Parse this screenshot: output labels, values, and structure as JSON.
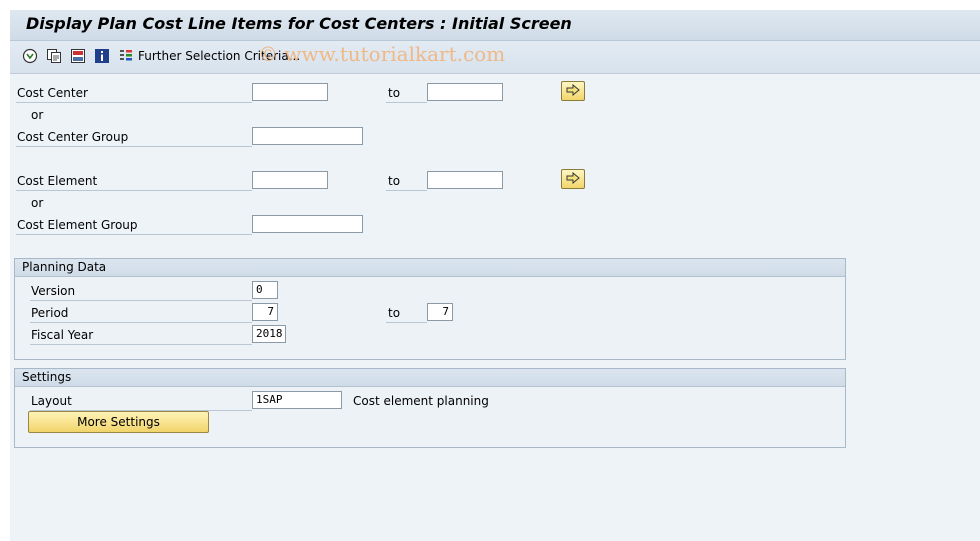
{
  "window": {
    "title": "Display Plan Cost Line Items for Cost Centers : Initial Screen"
  },
  "watermark": "© www.tutorialkart.com",
  "toolbar": {
    "further_selection_label": "Further Selection Criteria..."
  },
  "selection": {
    "cost_center_label": "Cost Center",
    "cost_center_from": "",
    "cost_center_to": "",
    "or_label_1": "or",
    "cost_center_group_label": "Cost Center Group",
    "cost_center_group": "",
    "cost_element_label": "Cost Element",
    "cost_element_from": "",
    "cost_element_to": "",
    "or_label_2": "or",
    "cost_element_group_label": "Cost Element Group",
    "cost_element_group": "",
    "to_label": "to"
  },
  "planning_data": {
    "title": "Planning Data",
    "version_label": "Version",
    "version": "0",
    "period_label": "Period",
    "period_from": "7",
    "period_to": "7",
    "to_label": "to",
    "fiscal_year_label": "Fiscal Year",
    "fiscal_year": "2018"
  },
  "settings": {
    "title": "Settings",
    "layout_label": "Layout",
    "layout": "1SAP",
    "layout_description": "Cost element planning",
    "more_settings_label": "More Settings"
  },
  "colors": {
    "title_bar": "#dfe8f1",
    "background": "#eef3f8",
    "button_yellow": "#f1d46a",
    "watermark": "#f0b47c"
  }
}
